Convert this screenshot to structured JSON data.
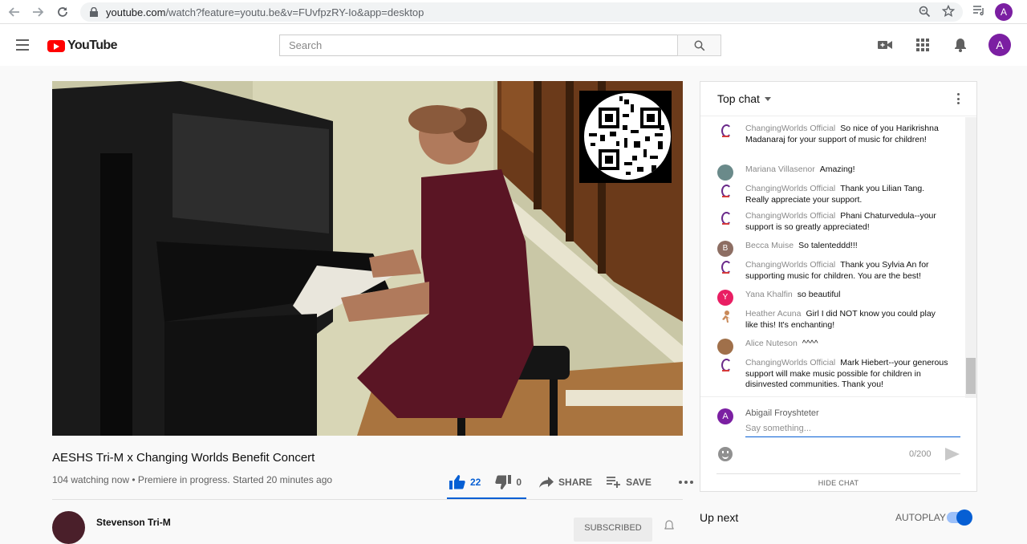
{
  "browser": {
    "url_host": "youtube.com",
    "url_rest": "/watch?feature=youtu.be&v=FUvfpzRY-Io&app=desktop",
    "profile_initial": "A"
  },
  "header": {
    "logo_text": "YouTube",
    "search_placeholder": "Search",
    "avatar_initial": "A"
  },
  "video": {
    "title": "AESHS Tri-M x Changing Worlds Benefit Concert",
    "meta": "104 watching now • Premiere in progress. Started 20 minutes ago",
    "likes": "22",
    "dislikes": "0",
    "share_label": "SHARE",
    "save_label": "SAVE"
  },
  "channel": {
    "name": "Stevenson Tri-M",
    "subscribe_label": "SUBSCRIBED"
  },
  "chat": {
    "header": "Top chat",
    "messages": [
      {
        "author": "ChangingWorlds Official",
        "text": "So nice of you Harikrishna Madanaraj for your support of music for children!"
      },
      {
        "author": "Mariana Villasenor",
        "text": "Amazing!"
      },
      {
        "author": "ChangingWorlds Official",
        "text": "Thank you Lilian Tang. Really appreciate your support."
      },
      {
        "author": "ChangingWorlds Official",
        "text": "Phani Chaturvedula--your support is so greatly appreciated!"
      },
      {
        "author": "Becca Muise",
        "text": "So talenteddd!!!",
        "initial": "B"
      },
      {
        "author": "ChangingWorlds Official",
        "text": "Thank you Sylvia An for supporting music for children. You are the best!"
      },
      {
        "author": "Yana Khalfin",
        "text": "so beautiful",
        "initial": "Y"
      },
      {
        "author": "Heather Acuna",
        "text": "Girl I did NOT know you could play like this! It's enchanting!"
      },
      {
        "author": "Alice Nuteson",
        "text": "^^^^"
      },
      {
        "author": "ChangingWorlds Official",
        "text": "Mark Hiebert--your generous support will make music possible for children in disinvested communities. Thank you!"
      }
    ],
    "input_user": "Abigail Froyshteter",
    "input_initial": "A",
    "input_placeholder": "Say something...",
    "char_count": "0/200",
    "hide_label": "HIDE CHAT"
  },
  "sidebar": {
    "up_next": "Up next",
    "autoplay": "AUTOPLAY"
  },
  "colors": {
    "accent": "#065fd4",
    "brand_red": "#ff0000",
    "avatar_purple": "#7b1fa2"
  }
}
